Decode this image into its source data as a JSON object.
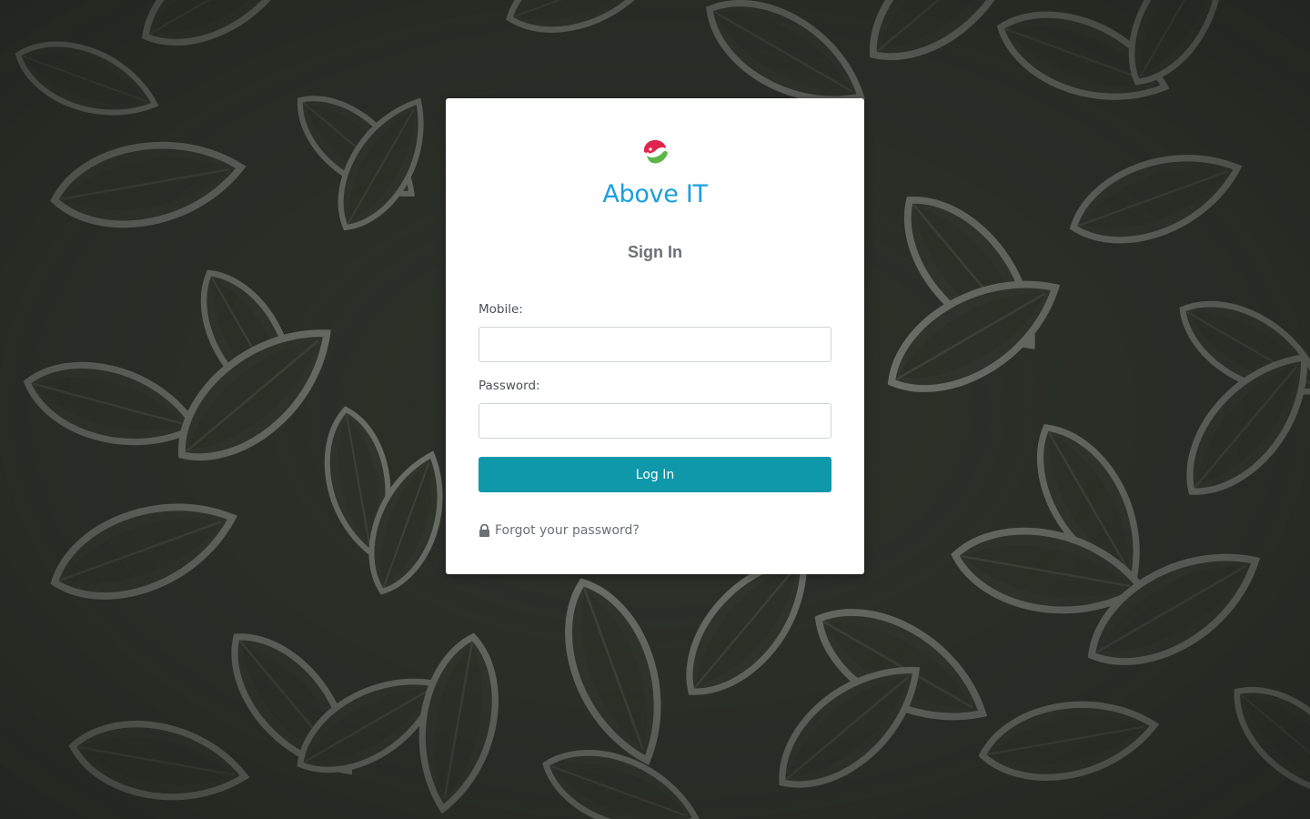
{
  "brand": {
    "name": "Above IT",
    "logo_icon": "above-it-logo-icon",
    "color": "#1a9fe0"
  },
  "form": {
    "title": "Sign In",
    "mobile_label": "Mobile:",
    "mobile_value": "",
    "password_label": "Password:",
    "password_value": "",
    "submit_label": "Log In",
    "forgot_label": "Forgot your password?",
    "forgot_icon": "lock-icon"
  },
  "colors": {
    "button": "#0e98aa",
    "background": "#2b2f29",
    "heading": "#6b7075"
  }
}
